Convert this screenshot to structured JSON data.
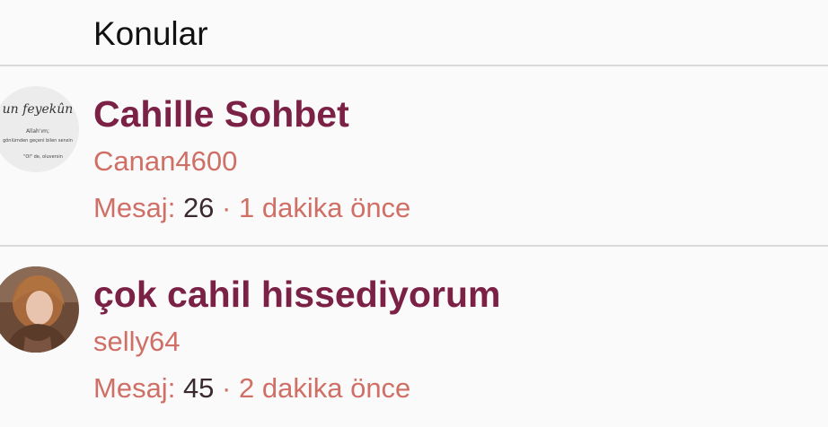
{
  "header": {
    "title": "Konular"
  },
  "topics": [
    {
      "title": "Cahille Sohbet",
      "author": "Canan4600",
      "message_label": "Mesaj:",
      "message_count": "26",
      "separator": "·",
      "time": "1 dakika önce",
      "avatar_text": [
        "un feyekûn",
        "Allah'ım;",
        "gönlümden geçeni bilen sensin",
        "\"Ol\" de, oluversin"
      ]
    },
    {
      "title": "çok cahil hissediyorum",
      "author": "selly64",
      "message_label": "Mesaj:",
      "message_count": "45",
      "separator": "·",
      "time": "2 dakika önce"
    }
  ],
  "colors": {
    "title": "#7b2146",
    "author": "#cf6f66",
    "count": "#3a2a30",
    "divider": "#d9d9d9",
    "background": "#fafafa"
  }
}
